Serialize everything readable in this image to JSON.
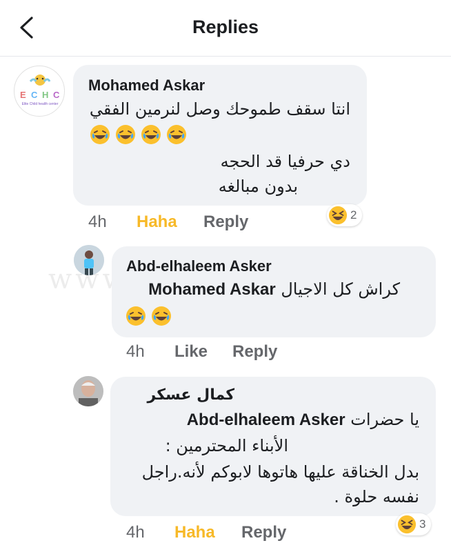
{
  "header": {
    "title": "Replies",
    "back_icon": "back-arrow-icon"
  },
  "watermark": "www.elfahmasr.com",
  "comments": [
    {
      "author": "Mohamed Askar",
      "avatar": {
        "logo_text": "E C H C",
        "subtext": "Elite Child health center"
      },
      "line1": "انتا سقف طموحك وصل لنرمين الفقي",
      "emoji": "laughing-crying-icon",
      "emoji_count_inline": 4,
      "line2": "دي حرفيا قد الحجه",
      "line3": "بدون مبالغه",
      "time": "4h",
      "reaction_label": "Haha",
      "reply_label": "Reply",
      "reaction_count": "2"
    },
    {
      "author": "Abd-elhaleem Asker",
      "mention": "Mohamed Askar",
      "line1_text": "كراش كل الاجيال",
      "emoji": "laughing-crying-icon",
      "emoji_count_inline": 2,
      "time": "4h",
      "like_label": "Like",
      "reply_label": "Reply"
    },
    {
      "author": "كمال عسكر",
      "mention": "Abd-elhaleem Asker",
      "line1_text": "يا حضرات",
      "line2": "الأبناء المحترمين :",
      "line3": "بدل الخناقة عليها هاتوها لابوكم لأنه.راجل",
      "line4": "نفسه حلوة .",
      "time": "4h",
      "reaction_label": "Haha",
      "reply_label": "Reply",
      "reaction_count": "3"
    }
  ],
  "colors": {
    "bubble": "#f0f2f5",
    "meta_text": "#65676b",
    "haha": "#f7b928",
    "emoji_face": "#fbc02d"
  }
}
